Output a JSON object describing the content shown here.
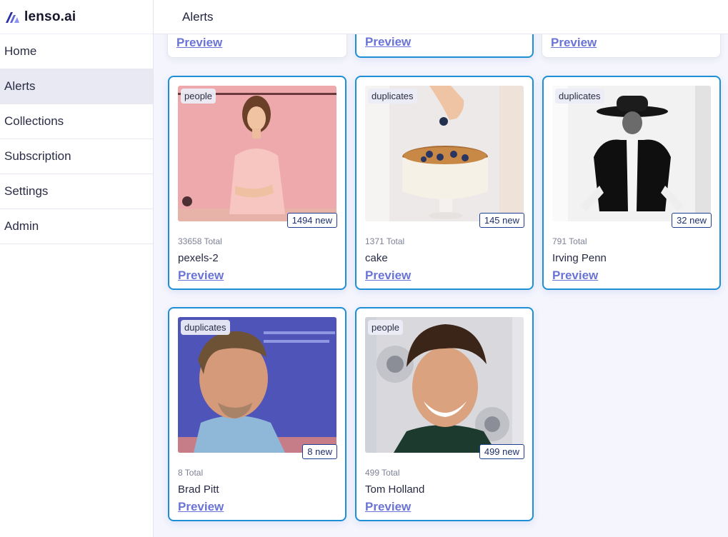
{
  "brand": {
    "name": "lenso.ai",
    "logo_icon": "lenso-logo-icon"
  },
  "sidebar": {
    "items": [
      {
        "label": "Home",
        "active": false
      },
      {
        "label": "Alerts",
        "active": true
      },
      {
        "label": "Collections",
        "active": false
      },
      {
        "label": "Subscription",
        "active": false
      },
      {
        "label": "Settings",
        "active": false
      },
      {
        "label": "Admin",
        "active": false
      }
    ]
  },
  "header": {
    "title": "Alerts"
  },
  "partial_cards": [
    {
      "preview": "Preview"
    },
    {
      "preview": "Preview"
    },
    {
      "preview": "Preview"
    }
  ],
  "cards": [
    {
      "tag": "people",
      "new": "1494 new",
      "total": "33658 Total",
      "title": "pexels-2",
      "preview": "Preview"
    },
    {
      "tag": "duplicates",
      "new": "145 new",
      "total": "1371 Total",
      "title": "cake",
      "preview": "Preview"
    },
    {
      "tag": "duplicates",
      "new": "32 new",
      "total": "791 Total",
      "title": "Irving Penn",
      "preview": "Preview"
    },
    {
      "tag": "duplicates",
      "new": "8 new",
      "total": "8 Total",
      "title": "Brad Pitt",
      "preview": "Preview"
    },
    {
      "tag": "people",
      "new": "499 new",
      "total": "499 Total",
      "title": "Tom Holland",
      "preview": "Preview"
    }
  ],
  "colors": {
    "accent_border": "#1e8fd4",
    "preview_link": "#6a74d6",
    "active_nav_bg": "#e8e9f2",
    "page_bg": "#f4f5fd"
  }
}
